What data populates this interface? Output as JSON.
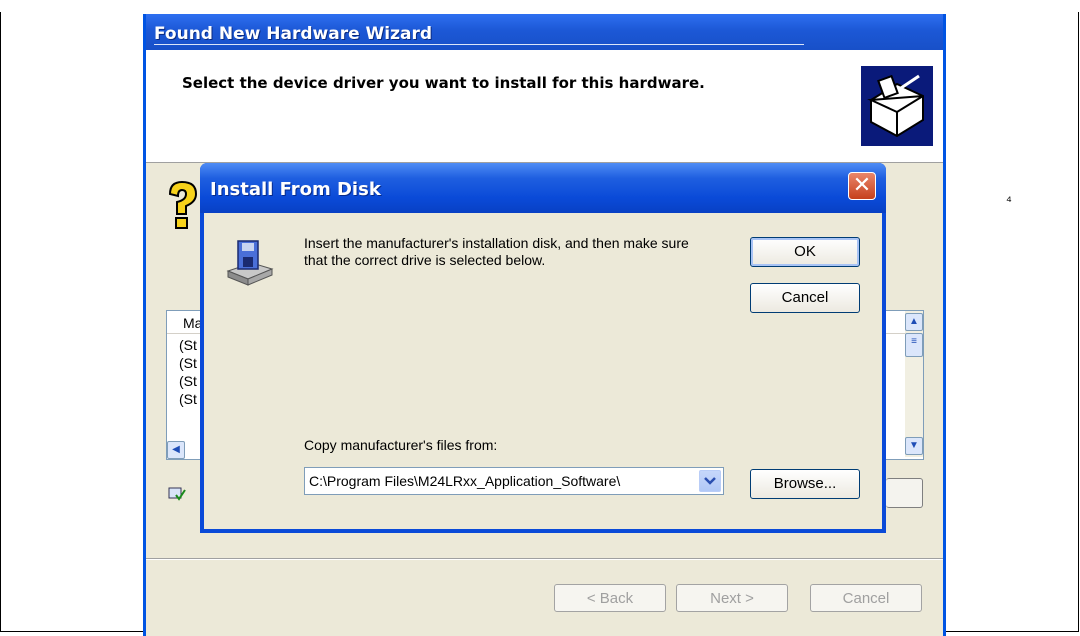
{
  "wizard": {
    "title": "Found New Hardware Wizard",
    "heading": "Select the device driver you want to install for this hardware.",
    "list_column": "Ma",
    "list_rows": [
      "(St",
      "(St",
      "(St",
      "(St"
    ],
    "buttons": {
      "back": "< Back",
      "next": "Next >",
      "cancel": "Cancel"
    }
  },
  "dialog": {
    "title": "Install From Disk",
    "message": "Insert the manufacturer's installation disk, and then make sure that the correct drive is selected below.",
    "ok_label": "OK",
    "cancel_label": "Cancel",
    "copy_label": "Copy manufacturer's files from:",
    "path_value": "C:\\Program Files\\M24LRxx_Application_Software\\",
    "browse_label": "Browse..."
  },
  "colors": {
    "titlebar": "#0a4ad8",
    "dialog_face": "#ece9d8",
    "close": "#c6401c"
  }
}
